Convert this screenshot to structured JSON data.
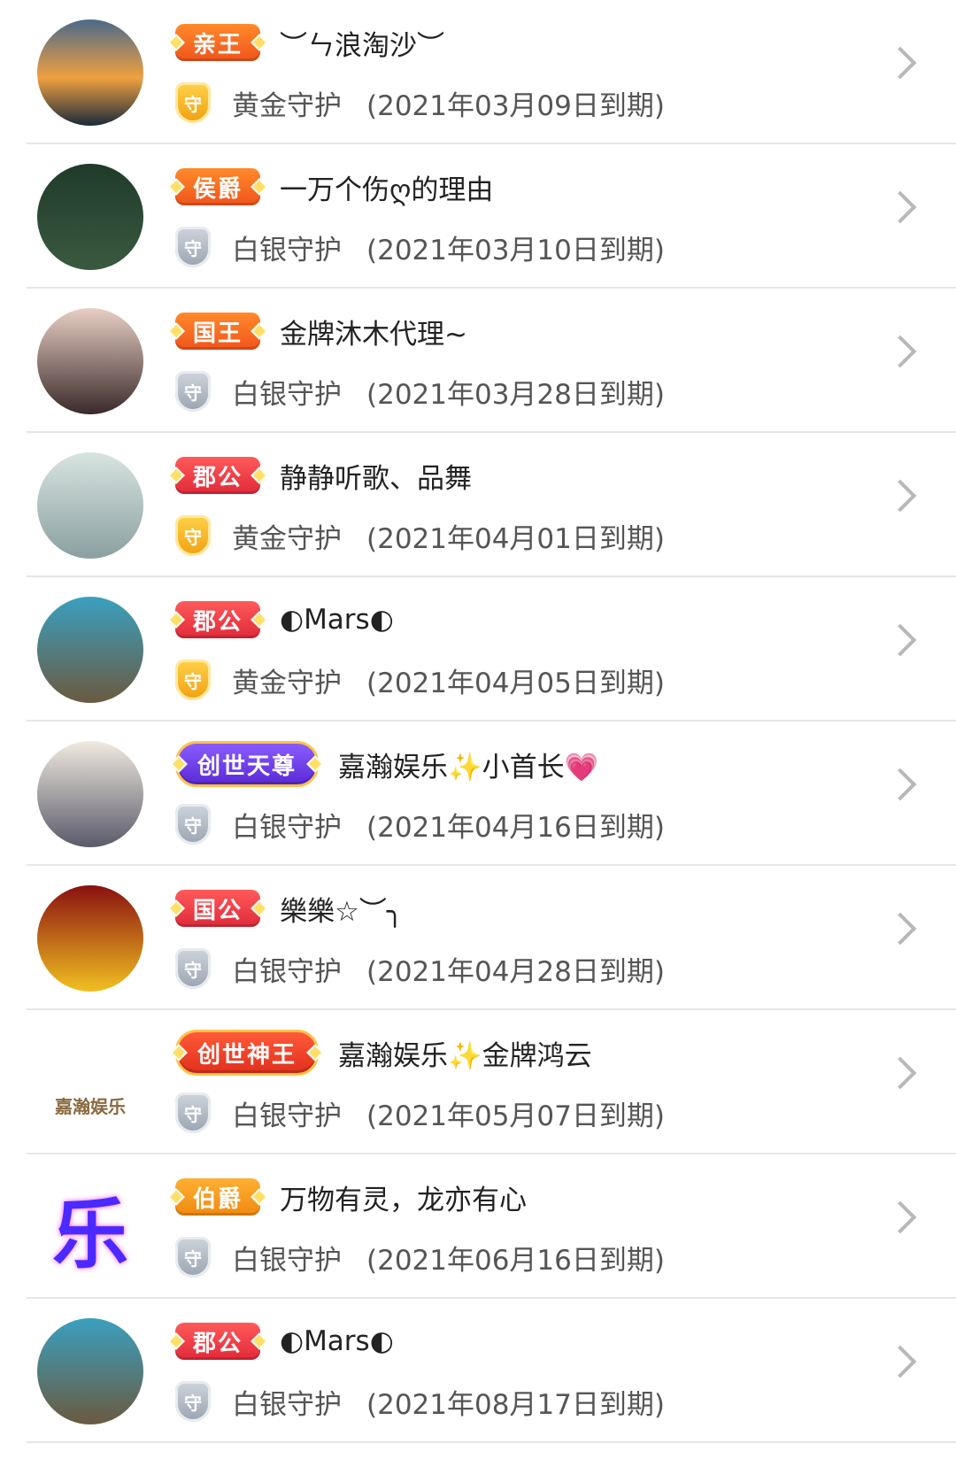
{
  "guards": [
    {
      "rank": "亲王",
      "rank_style": "rank-orange",
      "nickname": "︶ㄣ浪淘沙︶",
      "guard_type": "黄金守护",
      "guard_style": "shield-gold",
      "expiry": "(2021年03月09日到期)",
      "avatar_bg": "linear-gradient(#4a6a8a,#f0a040 55%,#1a2a3a)",
      "avatar_glyph": ""
    },
    {
      "rank": "侯爵",
      "rank_style": "rank-orange",
      "nickname": "一万个伤ღ的理由",
      "guard_type": "白银守护",
      "guard_style": "shield-silver",
      "expiry": "(2021年03月10日到期)",
      "avatar_bg": "linear-gradient(#1f3a2a,#3a5a40)",
      "avatar_glyph": ""
    },
    {
      "rank": "国王",
      "rank_style": "rank-orange",
      "nickname": "金牌沐木代理~",
      "guard_type": "白银守护",
      "guard_style": "shield-silver",
      "expiry": "(2021年03月28日到期)",
      "avatar_bg": "linear-gradient(#e8cfc4,#3a2a2a)",
      "avatar_glyph": ""
    },
    {
      "rank": "郡公",
      "rank_style": "rank-red",
      "nickname": "静静听歌、品舞",
      "guard_type": "黄金守护",
      "guard_style": "shield-gold",
      "expiry": "(2021年04月01日到期)",
      "avatar_bg": "linear-gradient(#d8e4e0,#8aa0a0)",
      "avatar_glyph": ""
    },
    {
      "rank": "郡公",
      "rank_style": "rank-red",
      "nickname": "◐Mars◐",
      "guard_type": "黄金守护",
      "guard_style": "shield-gold",
      "expiry": "(2021年04月05日到期)",
      "avatar_bg": "linear-gradient(#3aa0c0,#6a5a40)",
      "avatar_glyph": ""
    },
    {
      "rank": "创世天尊",
      "rank_style": "rank-purple rank-wide",
      "nickname": "嘉瀚娱乐✨小首长💗",
      "guard_type": "白银守护",
      "guard_style": "shield-silver",
      "expiry": "(2021年04月16日到期)",
      "avatar_bg": "linear-gradient(#f0eae0,#5a5a6a)",
      "avatar_glyph": ""
    },
    {
      "rank": "国公",
      "rank_style": "rank-red",
      "nickname": "樂樂☆︶╮",
      "guard_type": "白银守护",
      "guard_style": "shield-silver",
      "expiry": "(2021年04月28日到期)",
      "avatar_bg": "linear-gradient(#8a1010,#f0c020)",
      "avatar_glyph": ""
    },
    {
      "rank": "创世神王",
      "rank_style": "rank-royal rank-wide",
      "nickname": "嘉瀚娱乐✨金牌鸿云",
      "guard_type": "白银守护",
      "guard_style": "shield-silver",
      "expiry": "(2021年05月07日到期)",
      "avatar_bg": "#ffffff",
      "avatar_glyph": "嘉瀚娱乐"
    },
    {
      "rank": "伯爵",
      "rank_style": "rank-amber",
      "nickname": "万物有灵，龙亦有心",
      "guard_type": "白银守护",
      "guard_style": "shield-silver",
      "expiry": "(2021年06月16日到期)",
      "avatar_bg": "#ffffff",
      "avatar_glyph": "乐"
    },
    {
      "rank": "郡公",
      "rank_style": "rank-red",
      "nickname": "◐Mars◐",
      "guard_type": "白银守护",
      "guard_style": "shield-silver",
      "expiry": "(2021年08月17日到期)",
      "avatar_bg": "linear-gradient(#3aa0c0,#6a5a40)",
      "avatar_glyph": ""
    }
  ],
  "shield_glyph": "守",
  "icons": {
    "chevron": "chevron-right-icon",
    "shield": "guard-shield-icon"
  }
}
